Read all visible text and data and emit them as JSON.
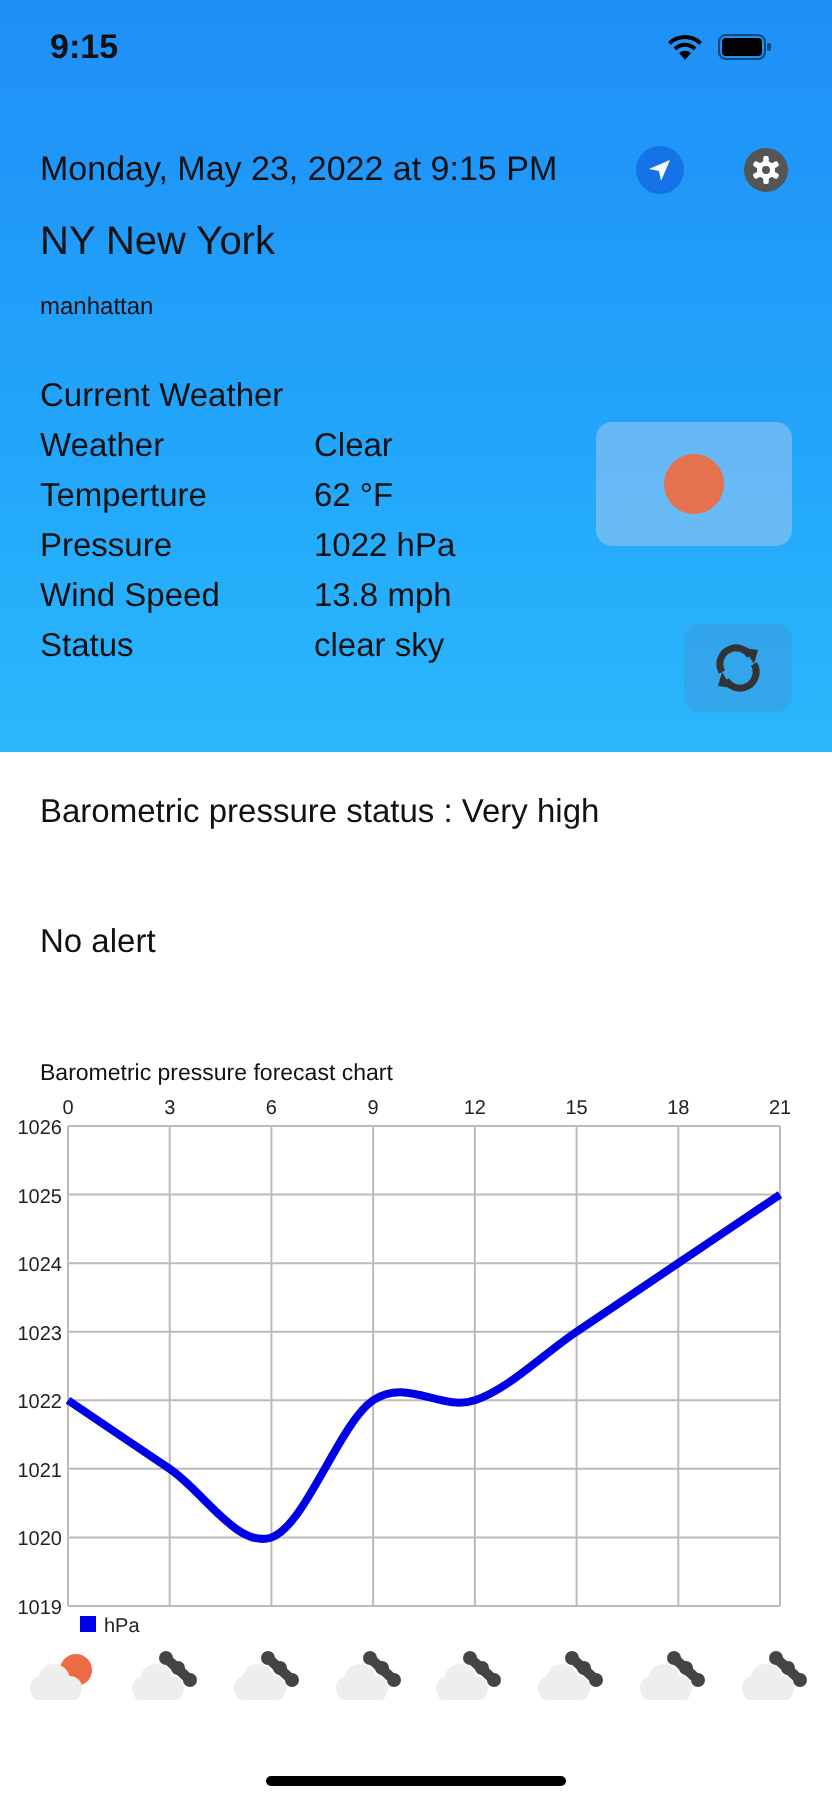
{
  "status_bar": {
    "time": "9:15"
  },
  "header": {
    "datetime": "Monday, May 23, 2022 at 9:15 PM",
    "city": "NY New York",
    "district": "manhattan"
  },
  "current_weather": {
    "title": "Current Weather",
    "rows": [
      {
        "label": "Weather",
        "value": "Clear"
      },
      {
        "label": "Temperture",
        "value": "62 °F"
      },
      {
        "label": "Pressure",
        "value": "1022 hPa"
      },
      {
        "label": "Wind Speed",
        "value": "13.8 mph"
      },
      {
        "label": "Status",
        "value": "clear sky"
      }
    ]
  },
  "pressure_status": "Barometric pressure status : Very high",
  "alert": "No alert",
  "forecast_chart": {
    "chart_data": {
      "type": "line",
      "title": "Barometric pressure forecast chart",
      "x": [
        0,
        3,
        6,
        9,
        12,
        15,
        18,
        21
      ],
      "series": [
        {
          "name": "hPa",
          "color": "#0000e6",
          "values": [
            1022,
            1021,
            1020,
            1022,
            1022,
            1023,
            1024,
            1025
          ]
        }
      ],
      "xticks": [
        0,
        3,
        6,
        9,
        12,
        15,
        18,
        21
      ],
      "yticks": [
        1019,
        1020,
        1021,
        1022,
        1023,
        1024,
        1025,
        1026
      ],
      "xlim": [
        0,
        21
      ],
      "ylim": [
        1019,
        1026
      ],
      "grid": true
    }
  },
  "forecast_icons": [
    {
      "kind": "day"
    },
    {
      "kind": "night"
    },
    {
      "kind": "night"
    },
    {
      "kind": "night"
    },
    {
      "kind": "night"
    },
    {
      "kind": "night"
    },
    {
      "kind": "night"
    },
    {
      "kind": "night"
    }
  ]
}
